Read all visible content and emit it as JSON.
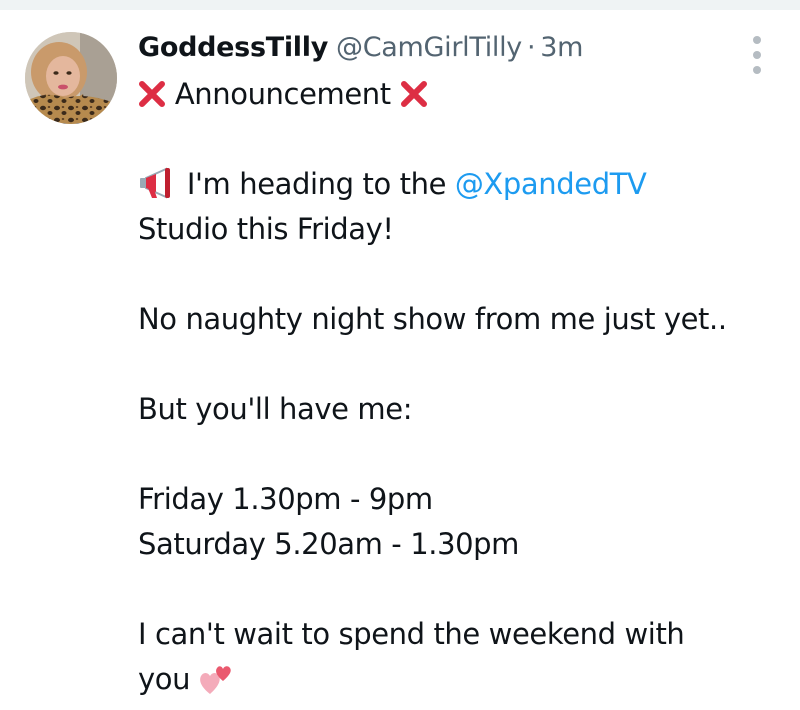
{
  "tweet": {
    "display_name": "GoddessTilly",
    "handle": "@CamGirlTilly",
    "separator": "·",
    "time": "3m",
    "avatar_icon": "user-avatar",
    "more_icon": "more-vertical-icon",
    "title_text": "Announcement",
    "title_icon": "red-cross-mark-icon",
    "line1_icon": "megaphone-icon",
    "line1_text": "I'm heading to the ",
    "mention": "@XpandedTV",
    "line2": "Studio this Friday!",
    "line3": "No naughty night show from me just yet..",
    "line4": "But you'll have me:",
    "line5": "Friday 1.30pm - 9pm",
    "line6": "Saturday 5.20am - 1.30pm",
    "line7": "I can't wait to spend the weekend with",
    "line8": "you",
    "line8_icon": "two-hearts-icon",
    "mention_color": "#1d9bf0",
    "cross_color": "#dd2e44"
  }
}
